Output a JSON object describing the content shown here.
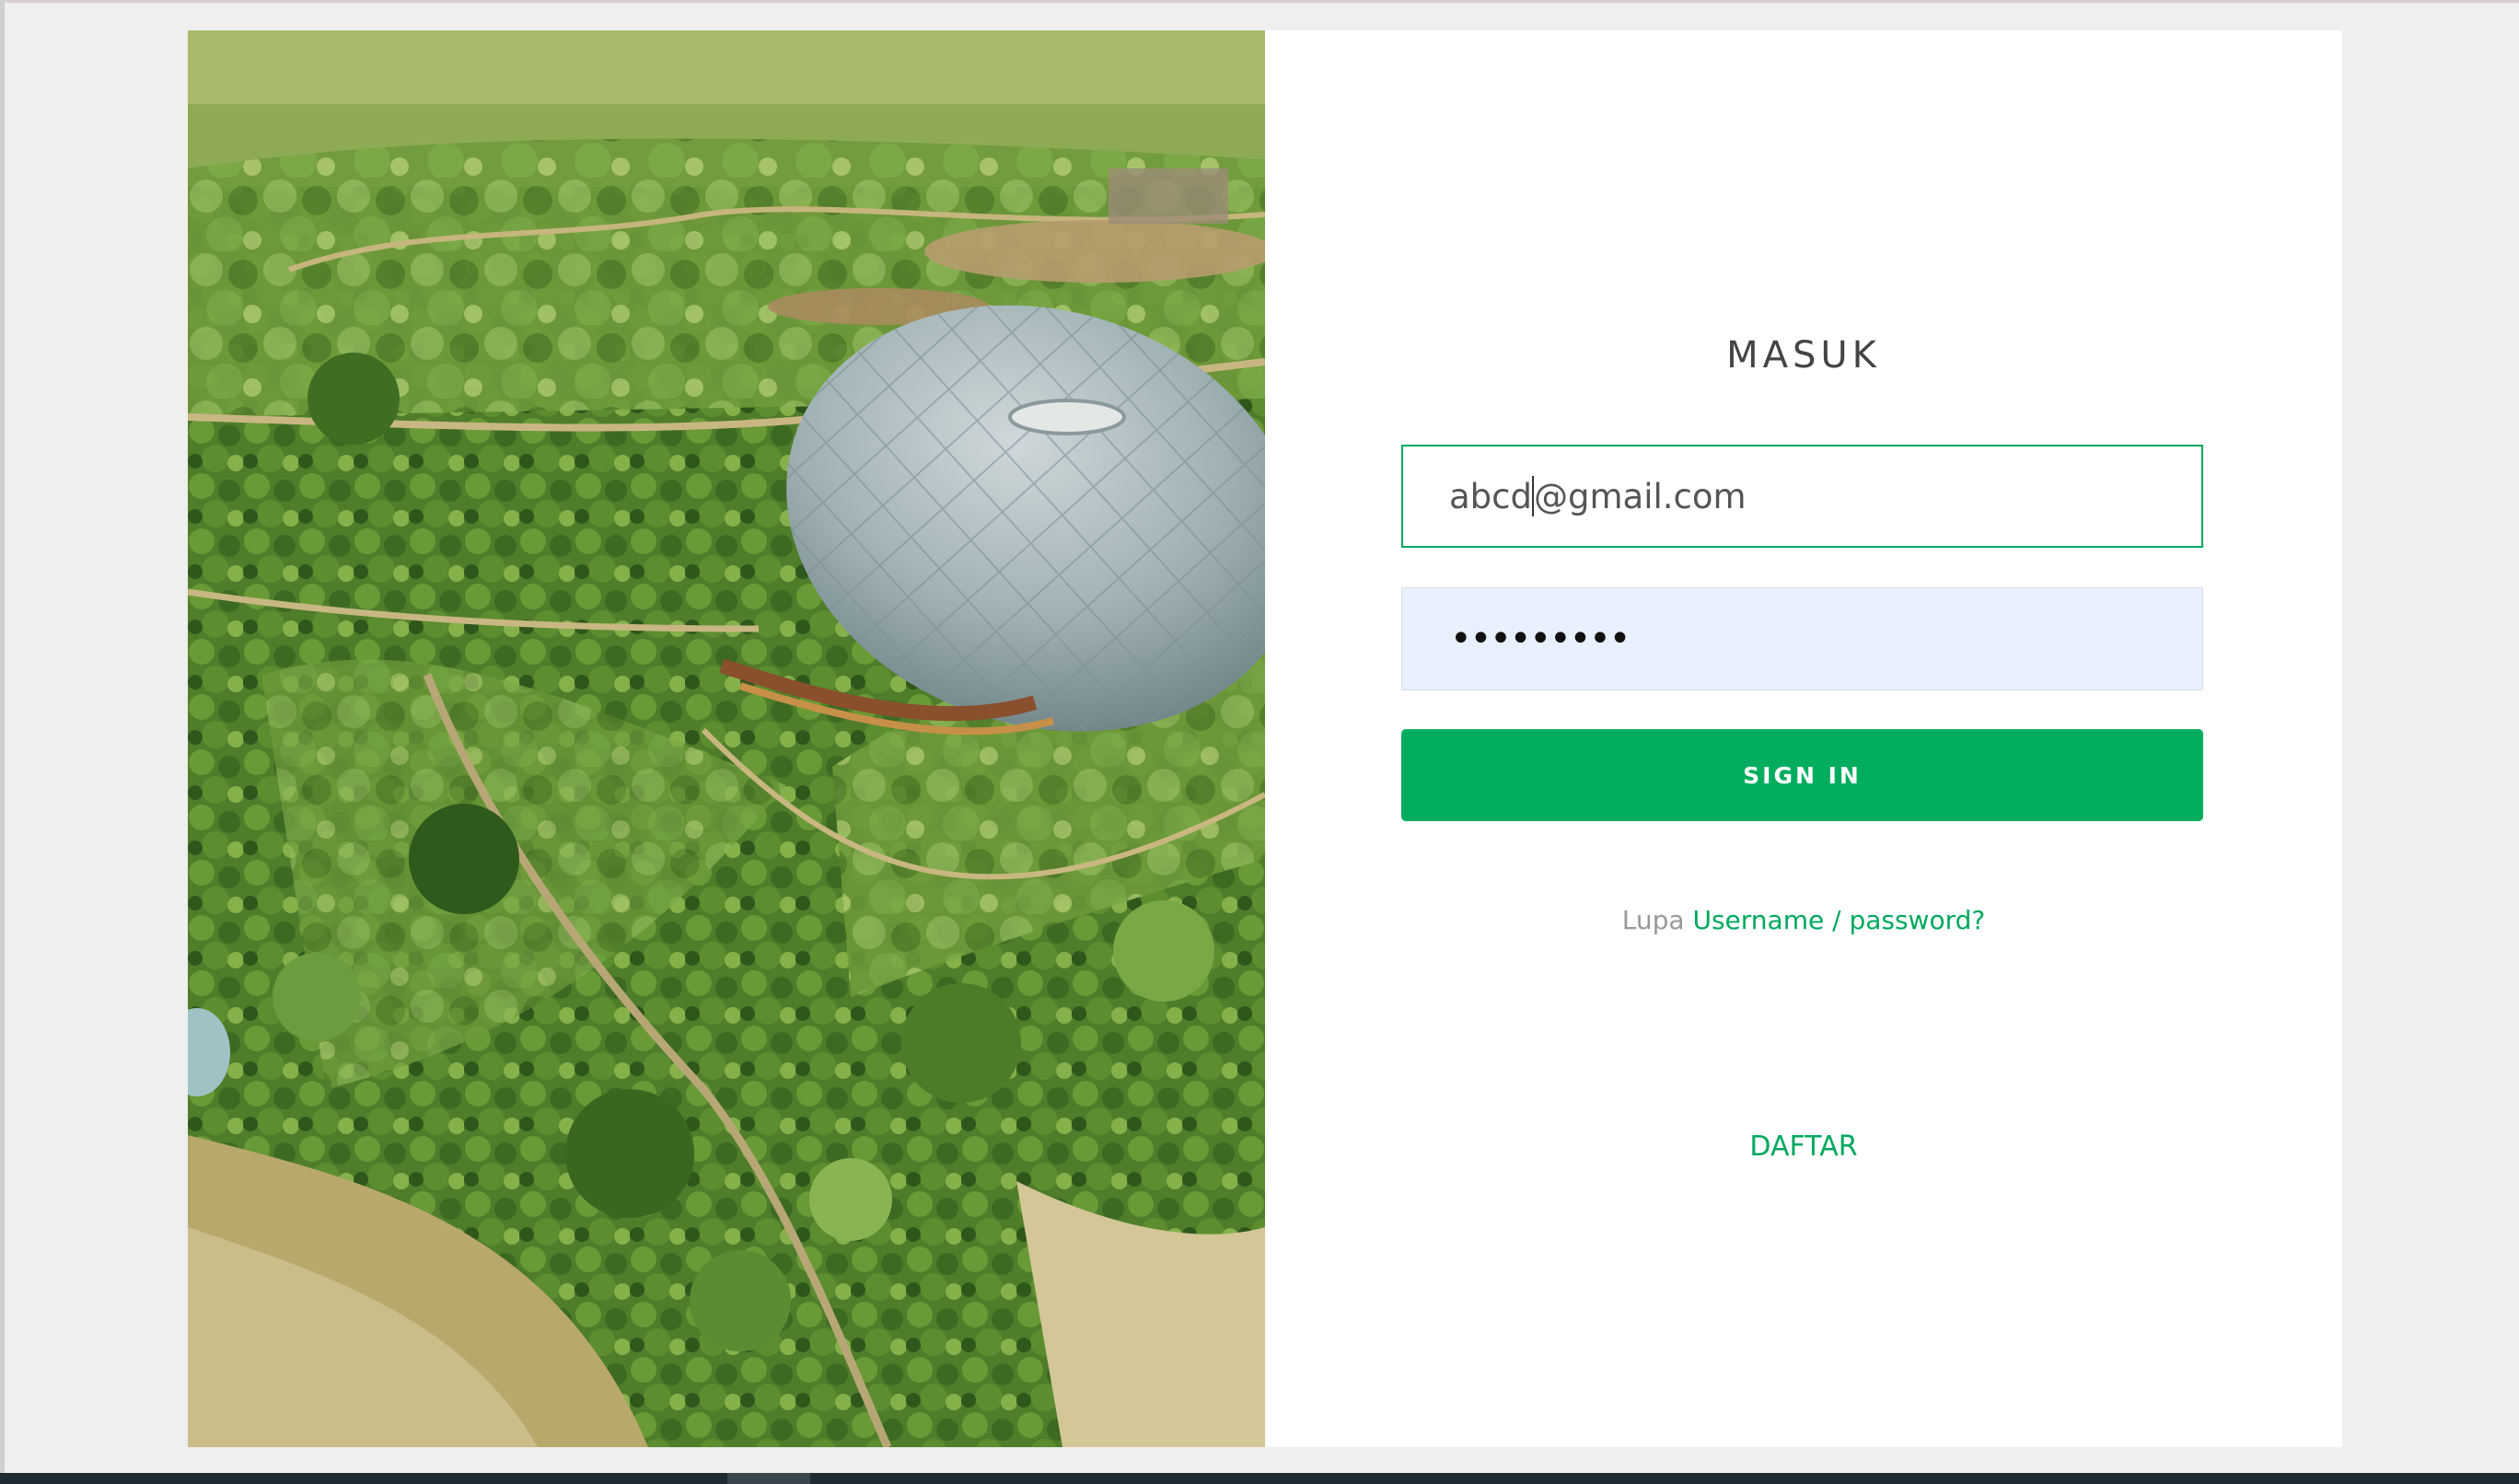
{
  "login": {
    "title": "MASUK",
    "email_value_before_caret": "abcd",
    "email_value_after_caret": "@gmail.com",
    "password_mask": "•••••••••",
    "signin_label": "SIGN IN",
    "forgot_prefix": "Lupa",
    "forgot_link": "Username / password?",
    "register_label": "DAFTAR"
  },
  "hero": {
    "image": "aerial-garden-dome-illustration"
  },
  "colors": {
    "accent": "#00ad5f",
    "autofill": "#e8f0fe",
    "page_bg": "#efefef"
  }
}
